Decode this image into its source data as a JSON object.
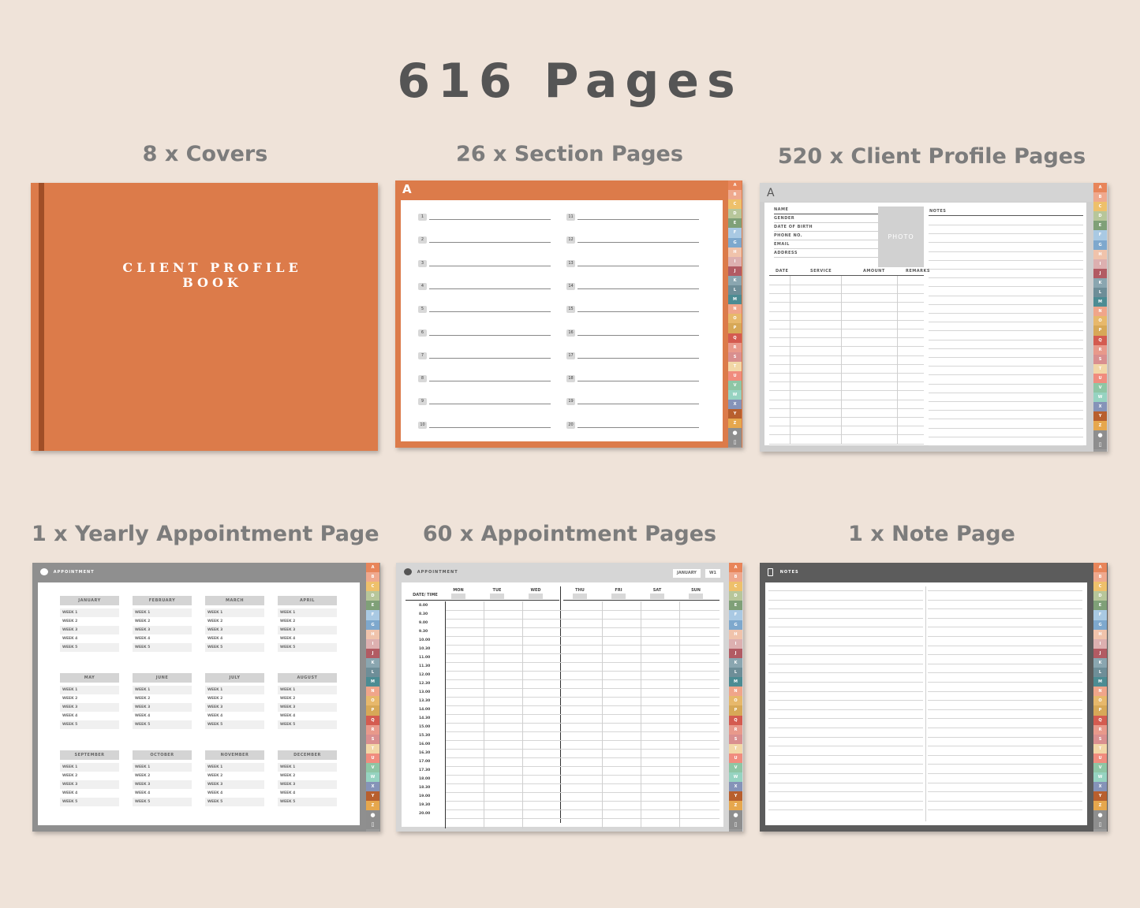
{
  "main_title": "616 Pages",
  "captions": {
    "covers": "8 x Covers",
    "sections": "26 x Section Pages",
    "profiles": "520 x Client Profile Pages",
    "yearly": "1 x Yearly Appointment Page",
    "appointments": "60 x Appointment Pages",
    "notes": "1 x Note Page"
  },
  "cover": {
    "title_line1": "CLIENT PROFILE",
    "title_line2": "BOOK"
  },
  "section_page": {
    "letter": "A",
    "numbers_left": [
      "1",
      "2",
      "3",
      "4",
      "5",
      "6",
      "7",
      "8",
      "9",
      "10"
    ],
    "numbers_right": [
      "11",
      "12",
      "13",
      "14",
      "15",
      "16",
      "17",
      "18",
      "19",
      "20"
    ]
  },
  "profile_page": {
    "letter": "A",
    "fields": [
      "NAME",
      "GENDER",
      "DATE OF BIRTH",
      "PHONE NO.",
      "EMAIL",
      "ADDRESS"
    ],
    "photo_label": "PHOTO",
    "notes_label": "NOTES",
    "service_columns": [
      "DATE",
      "SERVICE",
      "AMOUNT",
      "REMARKS"
    ]
  },
  "yearly_page": {
    "header": "APPOINTMENT",
    "months": [
      "JANUARY",
      "FEBRUARY",
      "MARCH",
      "APRIL",
      "MAY",
      "JUNE",
      "JULY",
      "AUGUST",
      "SEPTEMBER",
      "OCTOBER",
      "NOVEMBER",
      "DECEMBER"
    ],
    "weeks": [
      "WEEK 1",
      "WEEK 2",
      "WEEK 3",
      "WEEK 4",
      "WEEK 5"
    ]
  },
  "appointment_page": {
    "header": "APPOINTMENT",
    "month": "JANUARY",
    "week": "W1",
    "date_time_label": "DATE/ TIME",
    "days": [
      "MON",
      "TUE",
      "WED",
      "THU",
      "FRI",
      "SAT",
      "SUN"
    ],
    "times": [
      "8.00",
      "8.30",
      "9.00",
      "9.30",
      "10.00",
      "10.30",
      "11.00",
      "11.30",
      "12.00",
      "12.30",
      "13.00",
      "13.30",
      "14.00",
      "14.30",
      "15.00",
      "15.30",
      "16.00",
      "16.30",
      "17.00",
      "17.30",
      "18.00",
      "18.30",
      "19.00",
      "19.30",
      "20.00"
    ]
  },
  "notes_page": {
    "header": "NOTES"
  },
  "tabs": {
    "letters": [
      "A",
      "B",
      "C",
      "D",
      "E",
      "F",
      "G",
      "H",
      "I",
      "J",
      "K",
      "L",
      "M",
      "N",
      "O",
      "P",
      "Q",
      "R",
      "S",
      "T",
      "U",
      "V",
      "W",
      "X",
      "Y",
      "Z"
    ],
    "colors": [
      "#e8855a",
      "#efa98e",
      "#eec06b",
      "#b7c69a",
      "#7fa078",
      "#a9c9e3",
      "#7ea8cd",
      "#f0c3ab",
      "#ddb0b0",
      "#b25b63",
      "#8aa6b0",
      "#6e8e98",
      "#4c8c93",
      "#f0a58a",
      "#e7b86b",
      "#d7a857",
      "#d45b50",
      "#e8998b",
      "#d98f8f",
      "#f2d7a7",
      "#f08c7e",
      "#8ec6a5",
      "#96d3c1",
      "#8593b8",
      "#b85f2e",
      "#e6a74d"
    ],
    "icon_bear": "bear-icon",
    "icon_clipboard": "clipboard-icon"
  }
}
